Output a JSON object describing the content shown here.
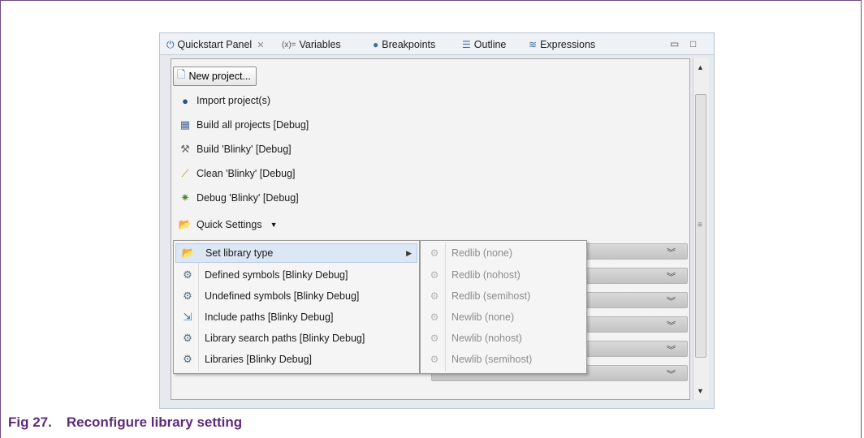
{
  "tabs": {
    "quickstart": {
      "label": "Quickstart Panel",
      "icon": "power-icon"
    },
    "variables": {
      "label": "Variables",
      "icon": "variables-icon",
      "prefix": "(x)="
    },
    "breakpoints": {
      "label": "Breakpoints",
      "icon": "breakpoints-icon"
    },
    "outline": {
      "label": "Outline",
      "icon": "outline-icon"
    },
    "expressions": {
      "label": "Expressions",
      "icon": "expressions-icon"
    }
  },
  "quickstart": {
    "new_project": "New project...",
    "import_project": "Import project(s)",
    "build_all": "Build all projects [Debug]",
    "build": "Build 'Blinky' [Debug]",
    "clean": "Clean 'Blinky' [Debug]",
    "debug": "Debug 'Blinky' [Debug]",
    "quick_settings": "Quick Settings"
  },
  "settings_menu": [
    "Set library type",
    "Defined symbols [Blinky Debug]",
    "Undefined symbols [Blinky Debug]",
    "Include paths [Blinky Debug]",
    "Library search paths [Blinky Debug]",
    "Libraries [Blinky Debug]"
  ],
  "library_menu": [
    "Redlib (none)",
    "Redlib (nohost)",
    "Redlib (semihost)",
    "Newlib (none)",
    "Newlib (nohost)",
    "Newlib (semihost)"
  ],
  "caption": {
    "number": "Fig 27.",
    "title": "Reconfigure library setting"
  },
  "colors": {
    "caption": "#5f2a7a",
    "frame": "#6b4d86",
    "selection": "#dbe7f5"
  }
}
